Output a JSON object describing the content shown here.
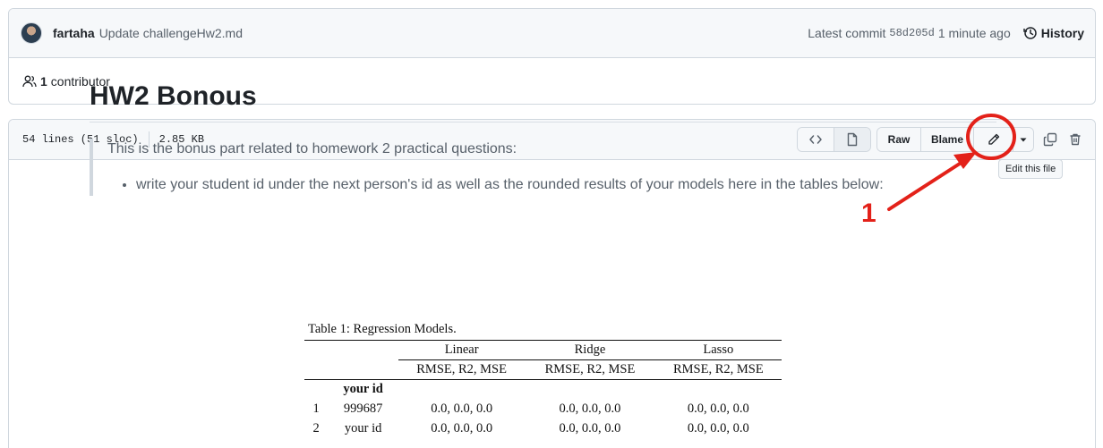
{
  "commit": {
    "author": "fartaha",
    "message": "Update challengeHw2.md",
    "latest_label": "Latest commit",
    "sha": "58d205d",
    "time": "1 minute ago",
    "history_label": "History"
  },
  "contributors": {
    "count": "1",
    "label": "contributor"
  },
  "file": {
    "lines": "54 lines (51 sloc)",
    "size": "2.85 KB",
    "raw_label": "Raw",
    "blame_label": "Blame",
    "tooltip": "Edit this file"
  },
  "content": {
    "title": "HW2 Bonous",
    "intro": "This is the bonus part related to homework 2 practical questions:",
    "bullet": "write your student id under the next person's id as well as the rounded results of your models here in the tables below:"
  },
  "table": {
    "caption": "Table 1: Regression Models.",
    "models": [
      "Linear",
      "Ridge",
      "Lasso"
    ],
    "metrics": "RMSE, R2, MSE",
    "id_header": "your id",
    "rows": [
      {
        "num": "1",
        "id": "999687",
        "linear": "0.0, 0.0, 0.0",
        "ridge": "0.0, 0.0, 0.0",
        "lasso": "0.0, 0.0, 0.0"
      },
      {
        "num": "2",
        "id": "your id",
        "linear": "0.0, 0.0, 0.0",
        "ridge": "0.0, 0.0, 0.0",
        "lasso": "0.0, 0.0, 0.0"
      }
    ]
  },
  "annotation": {
    "number": "1",
    "color": "#e32119"
  }
}
